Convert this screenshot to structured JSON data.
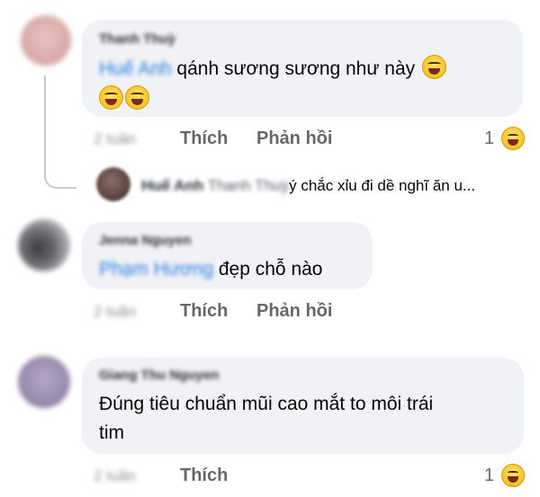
{
  "comments": [
    {
      "author": "Thanh Thuỳ",
      "mention": "Huế Anh",
      "text": " qánh sương sương như này",
      "timestamp": "2 tuần",
      "like_label": "Thích",
      "reply_label": "Phản hồi",
      "reaction_count": "1",
      "reaction_icon": "laughing-emoji-icon"
    },
    {
      "author": "Jenna Nguyen",
      "mention": "Phạm Hương",
      "text": " đẹp chỗ nào",
      "timestamp": "2 tuần",
      "like_label": "Thích",
      "reply_label": "Phản hồi"
    },
    {
      "author": "Giang Thu Nguyen",
      "text_line1": "Đúng tiêu chuẩn mũi cao mắt to môi trái",
      "text_line2": "tim",
      "timestamp": "2 tuần",
      "like_label": "Thích",
      "reaction_count": "1",
      "reaction_icon": "laughing-emoji-icon"
    }
  ],
  "reply_preview": {
    "author": "Huế Anh",
    "mention": "Thanh Thuỳ",
    "text": "ý chắc xỉu đi dề nghĩ ăn u..."
  },
  "colors": {
    "bubble": "#f0f2f5",
    "mention": "#2a7de1",
    "meta": "#65676b"
  }
}
